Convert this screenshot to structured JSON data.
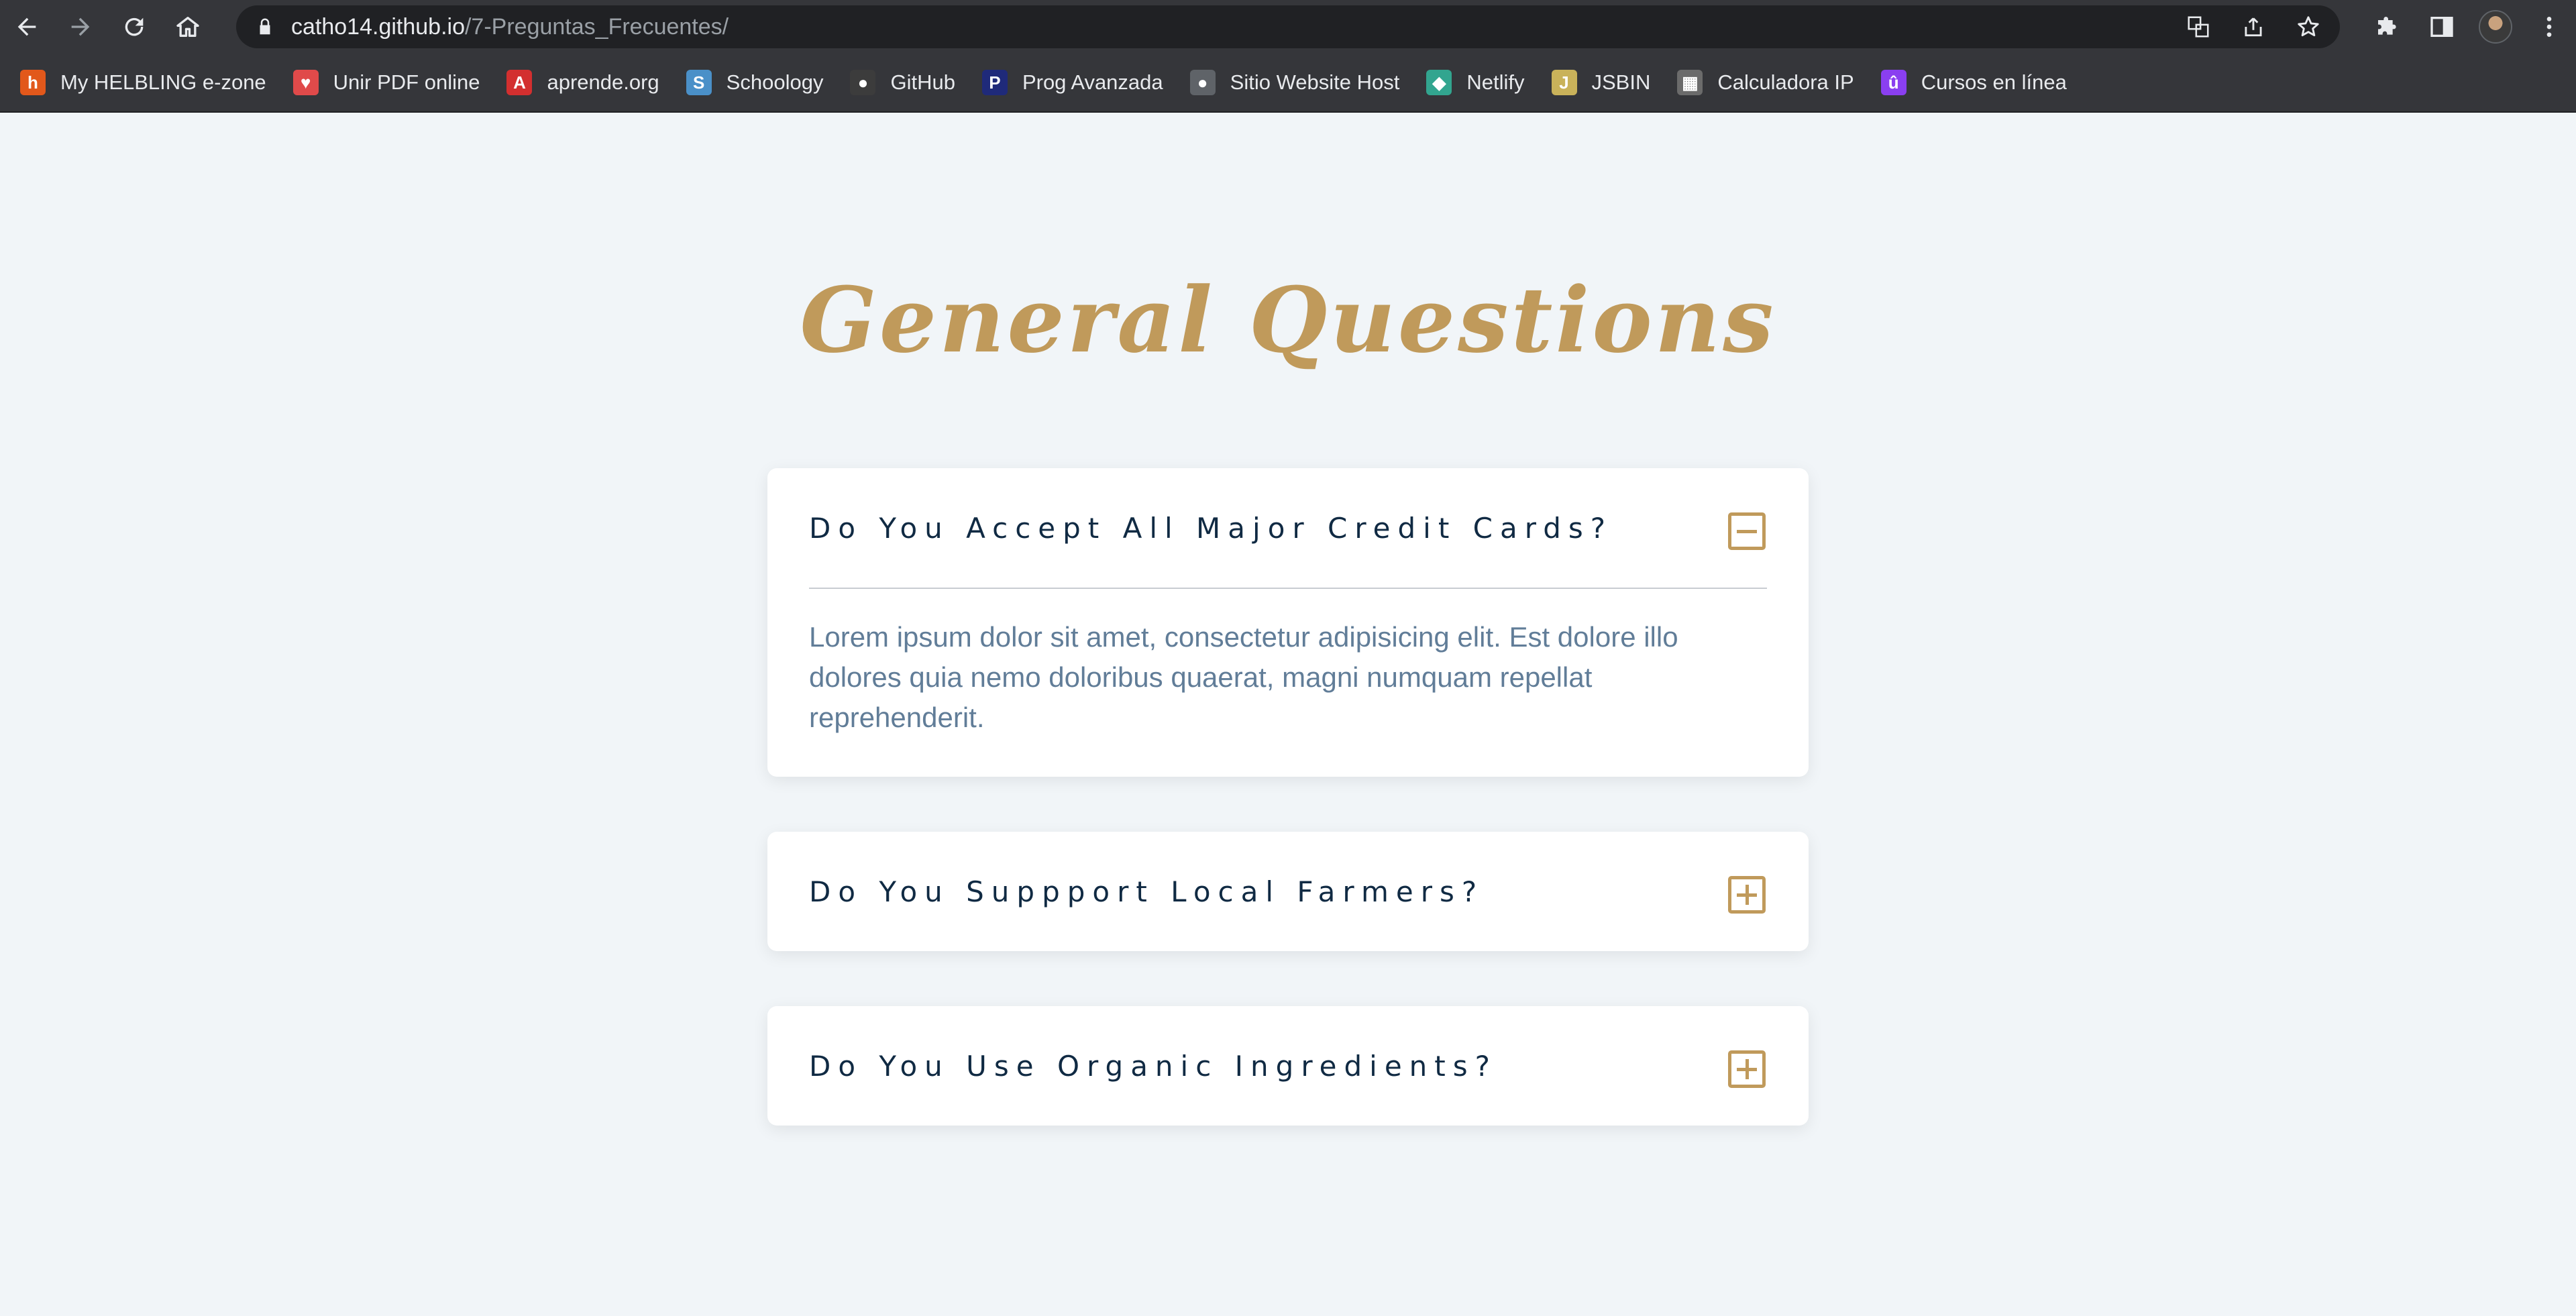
{
  "browser": {
    "url_host": "catho14.github.io",
    "url_path": "/7-Preguntas_Frecuentes/",
    "bookmarks": [
      {
        "label": "My HELBLING e-zone",
        "icon": "helbling-icon",
        "color": "#e2581b",
        "glyph": "h"
      },
      {
        "label": "Unir PDF online",
        "icon": "heart-icon",
        "color": "#e04a4a",
        "glyph": "♥"
      },
      {
        "label": "aprende.org",
        "icon": "aprende-icon",
        "color": "#d32f2f",
        "glyph": "A"
      },
      {
        "label": "Schoology",
        "icon": "schoology-icon",
        "color": "#4a90c8",
        "glyph": "S"
      },
      {
        "label": "GitHub",
        "icon": "github-icon",
        "color": "#3c3c3c",
        "glyph": "●"
      },
      {
        "label": "Prog Avanzada",
        "icon": "prog-icon",
        "color": "#1f2a7a",
        "glyph": "P"
      },
      {
        "label": "Sitio Website Host",
        "icon": "globe-icon",
        "color": "#5f6368",
        "glyph": "●"
      },
      {
        "label": "Netlify",
        "icon": "netlify-icon",
        "color": "#32a58f",
        "glyph": "◆"
      },
      {
        "label": "JSBIN",
        "icon": "jsbin-icon",
        "color": "#c9b25a",
        "glyph": "J"
      },
      {
        "label": "Calculadora IP",
        "icon": "calculator-icon",
        "color": "#6b6b6b",
        "glyph": "▦"
      },
      {
        "label": "Cursos en línea",
        "icon": "udemy-icon",
        "color": "#8a3ff0",
        "glyph": "û"
      }
    ]
  },
  "page": {
    "title": "General Questions",
    "questions": [
      {
        "question": "Do You Accept All Major Credit Cards?",
        "expanded": true,
        "answer": "Lorem ipsum dolor sit amet, consectetur adipisicing elit. Est dolore illo dolores quia nemo doloribus quaerat, magni numquam repellat reprehenderit."
      },
      {
        "question": "Do You Suppport Local Farmers?",
        "expanded": false
      },
      {
        "question": "Do You Use Organic Ingredients?",
        "expanded": false
      }
    ]
  },
  "colors": {
    "accent": "#c09a5b",
    "heading": "#102a43",
    "body_text": "#617d98",
    "page_bg": "#f1f5f8",
    "chrome_bg": "#35363a"
  }
}
